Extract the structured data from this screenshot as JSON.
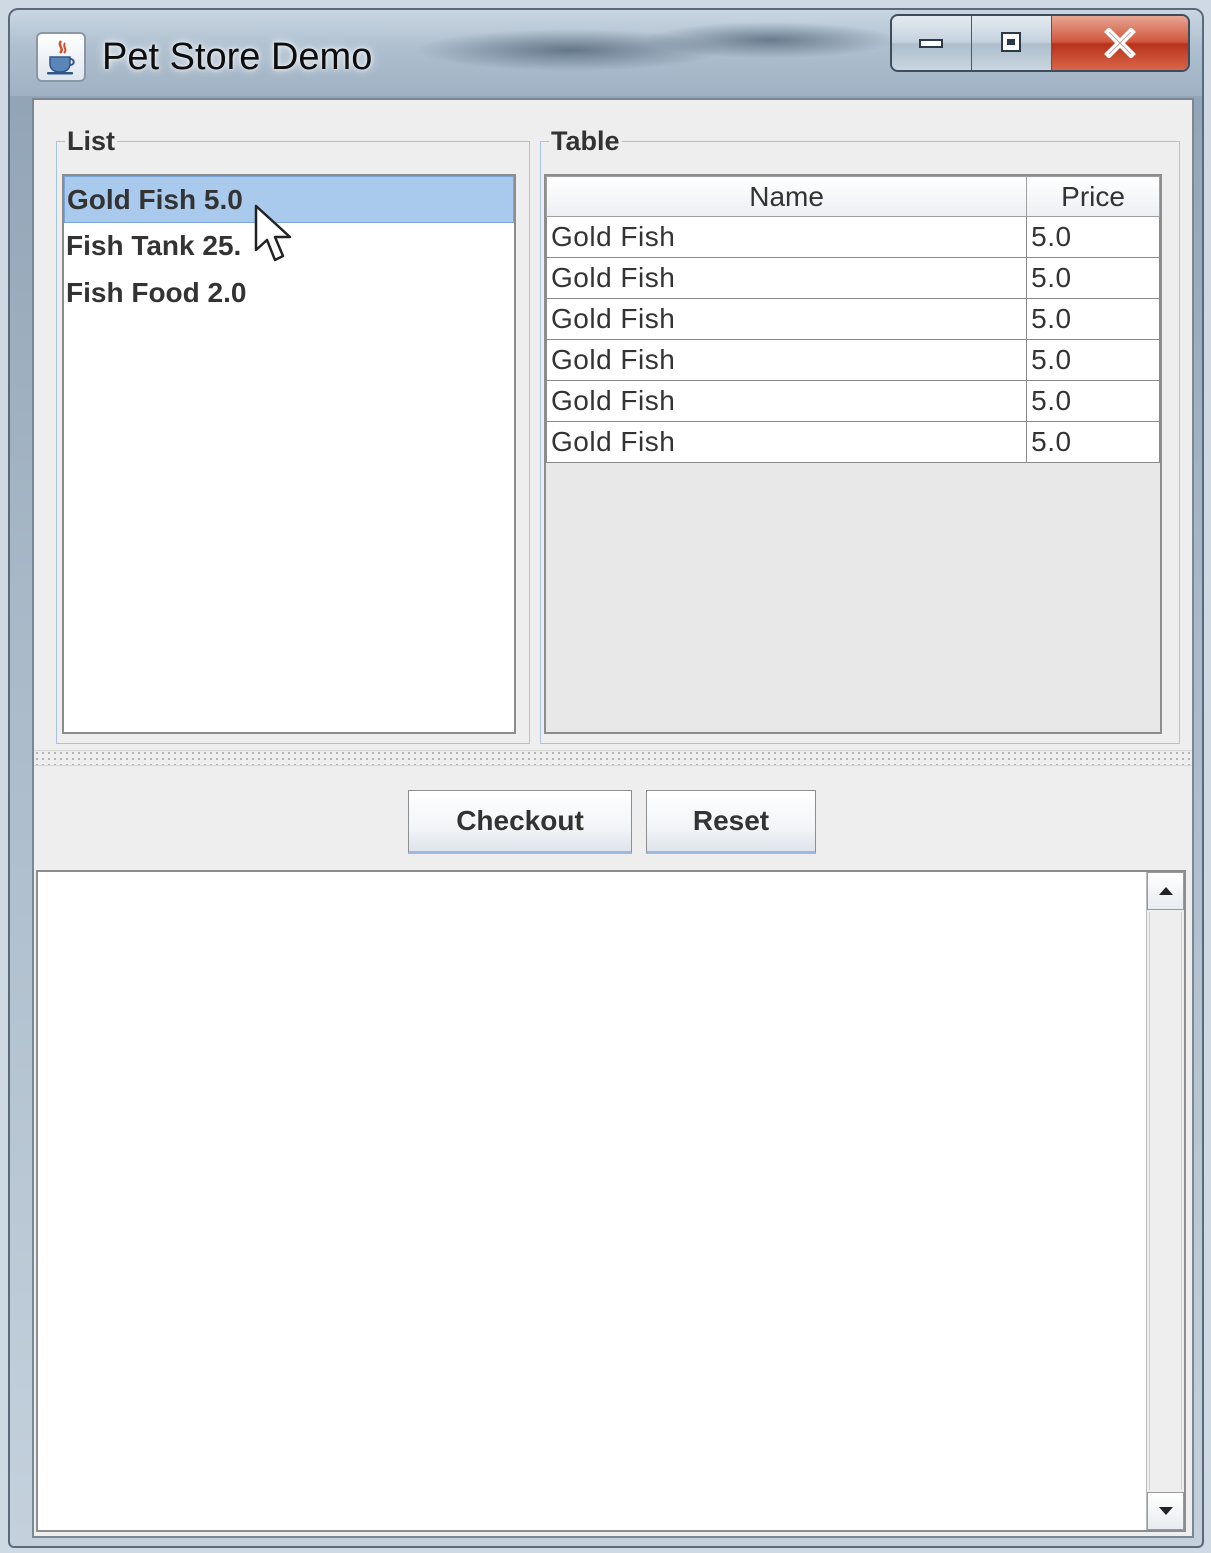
{
  "window": {
    "title": "Pet Store Demo",
    "app_icon": "java-cup-icon",
    "controls": [
      "minimize-icon",
      "maximize-icon",
      "close-icon"
    ]
  },
  "list_panel": {
    "title": "List",
    "items": [
      {
        "label": "Gold Fish 5.0",
        "selected": true
      },
      {
        "label": "Fish Tank 25.",
        "selected": false
      },
      {
        "label": "Fish Food 2.0",
        "selected": false
      }
    ]
  },
  "table_panel": {
    "title": "Table",
    "columns": [
      "Name",
      "Price"
    ],
    "rows": [
      [
        "Gold Fish",
        "5.0"
      ],
      [
        "Gold Fish",
        "5.0"
      ],
      [
        "Gold Fish",
        "5.0"
      ],
      [
        "Gold Fish",
        "5.0"
      ],
      [
        "Gold Fish",
        "5.0"
      ],
      [
        "Gold Fish",
        "5.0"
      ]
    ]
  },
  "actions": {
    "checkout_label": "Checkout",
    "reset_label": "Reset"
  },
  "output": {
    "text": ""
  },
  "colors": {
    "selection": "#a9c9ed",
    "group_border": "#a7c2e3",
    "close_button": "#c8452b"
  }
}
